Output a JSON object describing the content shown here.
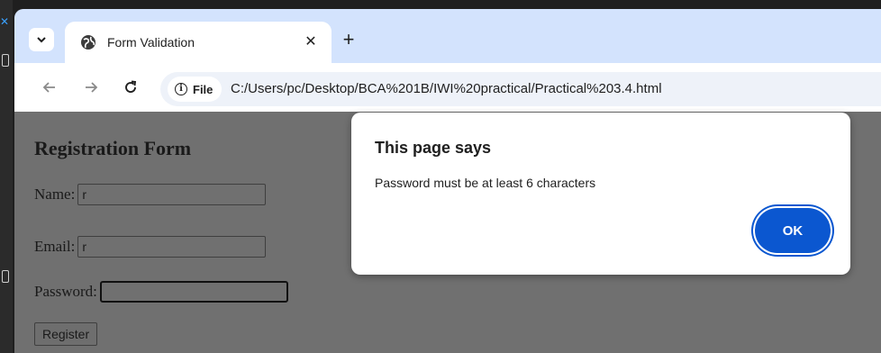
{
  "browser": {
    "tab": {
      "title": "Form Validation"
    },
    "address": {
      "scheme_label": "File",
      "url": "C:/Users/pc/Desktop/BCA%201B/IWI%20practical/Practical%203.4.html"
    }
  },
  "page": {
    "heading": "Registration Form",
    "fields": {
      "name": {
        "label": "Name:",
        "value": "r"
      },
      "email": {
        "label": "Email:",
        "value": "r"
      },
      "password": {
        "label": "Password:",
        "value": ""
      }
    },
    "register_label": "Register"
  },
  "dialog": {
    "title": "This page says",
    "message": "Password must be at least 6 characters",
    "ok_label": "OK"
  },
  "colors": {
    "tabstrip": "#d3e3fd",
    "accent": "#0b57d0",
    "overlay": "#707070"
  }
}
